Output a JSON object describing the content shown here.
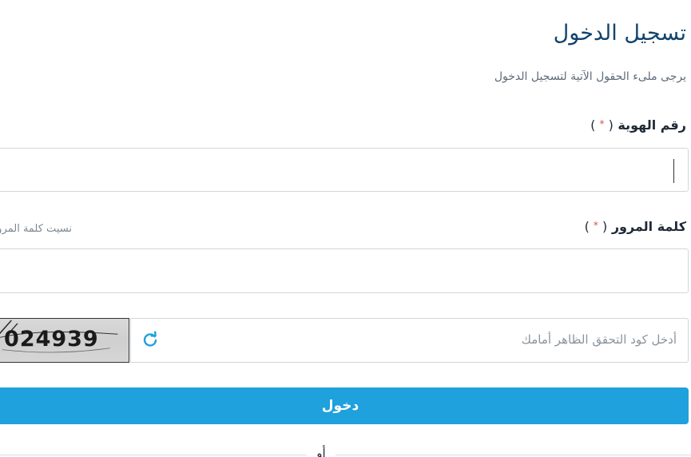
{
  "header": {
    "title": "تسجيل الدخول",
    "subtitle": "يرجى ملىء الحقول الآتية لتسجيل الدخول"
  },
  "id_field": {
    "label": "رقم الهوية",
    "required_open": "( ",
    "required_mark": "*",
    "required_close": " )",
    "value": ""
  },
  "password_field": {
    "label": "كلمة المرور",
    "required_open": "( ",
    "required_mark": "*",
    "required_close": " )",
    "forgot_link": "نسيت كلمة المرور",
    "value": ""
  },
  "captcha": {
    "placeholder": "أدخل كود التحقق الظاهر أمامك",
    "image_code": "024939",
    "refresh_icon": "refresh-icon"
  },
  "actions": {
    "submit_label": "دخول",
    "or_label": "أو"
  },
  "colors": {
    "title": "#12446d",
    "accent": "#1ea1dc",
    "required": "#e24b4b"
  }
}
